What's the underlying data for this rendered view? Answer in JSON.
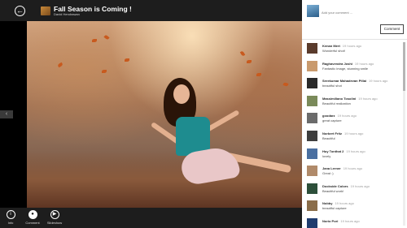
{
  "header": {
    "back_icon": "back-arrow-icon",
    "title": "Fall Season is Coming !",
    "author": "David Hendrawan"
  },
  "toolbar": {
    "actions": [
      {
        "label": "Info",
        "icon": "info-icon"
      },
      {
        "label": "Comment",
        "icon": "comment-icon"
      },
      {
        "label": "Slideshow",
        "icon": "play-icon"
      }
    ]
  },
  "comments_panel": {
    "input_placeholder": "Add your comment ...",
    "submit_label": "Comment",
    "comments": [
      {
        "name": "Kenan Mert",
        "time": "19 hours ago",
        "text": "Wonderful shot!",
        "avatar_color": "#5a3b2c"
      },
      {
        "name": "Raghavendra Joshi",
        "time": "19 hours ago",
        "text": "Fantastic image, stunning smile",
        "avatar_color": "#c99a6d"
      },
      {
        "name": "Sreekumar Mahadevan Pillai",
        "time": "19 hours ago",
        "text": "beautiful shot",
        "avatar_color": "#2a2a2a"
      },
      {
        "name": "Massimiliano Tosolini",
        "time": "19 hours ago",
        "text": "Beautiful realization",
        "avatar_color": "#7a8a5a"
      },
      {
        "name": "goodarz",
        "time": "19 hours ago",
        "text": "great capture",
        "avatar_color": "#6b6b6b"
      },
      {
        "name": "Norbert Fritz",
        "time": "19 hours ago",
        "text": "Beautiful",
        "avatar_color": "#3e3e3e"
      },
      {
        "name": "Huy Tonthat 2",
        "time": "19 hours ago",
        "text": "lovely",
        "avatar_color": "#4a6fa0"
      },
      {
        "name": "Jana Lerner",
        "time": "19 hours ago",
        "text": "Great :)",
        "avatar_color": "#b08a6a"
      },
      {
        "name": "Dockside Colors",
        "time": "19 hours ago",
        "text": "Beautiful work!",
        "avatar_color": "#2d4f3a"
      },
      {
        "name": "Nobby",
        "time": "19 hours ago",
        "text": "beautiful capture",
        "avatar_color": "#8a6d4a"
      },
      {
        "name": "Norio Pori",
        "time": "19 hours ago",
        "text": "",
        "avatar_color": "#1f3c6e"
      }
    ]
  }
}
